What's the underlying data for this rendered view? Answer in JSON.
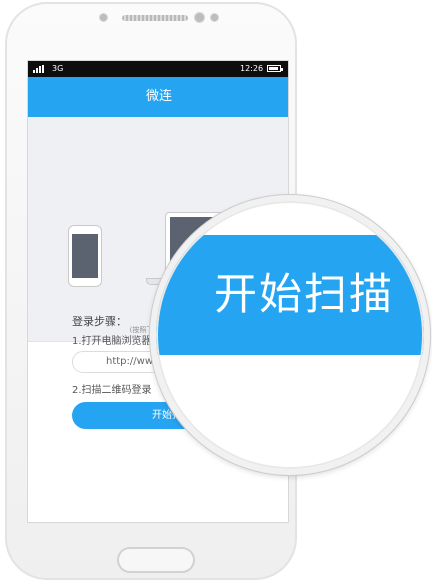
{
  "status_bar": {
    "network": "3G",
    "time": "12:26"
  },
  "app": {
    "title": "微连"
  },
  "illustration": {
    "hint": "(按照下面步骤让手"
  },
  "instructions": {
    "heading": "登录步骤：",
    "step1": "1.打开电脑浏览器",
    "url": "http://www",
    "step2": "2.扫描二维码登录"
  },
  "start_button": {
    "label": "开始扫描"
  },
  "magnifier": {
    "label": "开始扫描"
  },
  "colors": {
    "accent": "#25a4f2",
    "status_bar": "#0d0d0d",
    "illustration_bg": "#eef0f4",
    "device_screen": "#5b6370"
  },
  "icons": [
    "signal-icon",
    "battery-icon",
    "phone-device-icon",
    "laptop-device-icon"
  ]
}
